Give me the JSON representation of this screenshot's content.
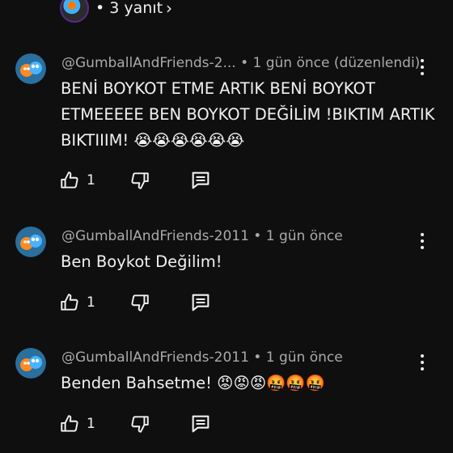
{
  "top_reply_bar": {
    "replies_label": "• 3 yanıt",
    "chevron_icon": "chevron-right-icon"
  },
  "comments": [
    {
      "author": "@GumballAndFriends-2...",
      "meta_suffix": "• 1 gün önce (düzenlendi)",
      "text": "BENİ BOYKOT ETME ARTIK BENİ BOYKOT ETMEEEEE BEN BOYKOT DEĞİLİM !BIKTIM ARTIK BIKTIIIM! 😭😭😭😭😭😭",
      "likes": "1"
    },
    {
      "author": "@GumballAndFriends-2011",
      "meta_suffix": "• 1 gün önce",
      "text": "Ben Boykot Değilim!",
      "likes": "1"
    },
    {
      "author": "@GumballAndFriends-2011",
      "meta_suffix": "• 1 gün önce",
      "text": "Benden Bahsetme! 😡😡😡🤬🤬🤬",
      "likes": "1"
    }
  ],
  "icons": {
    "like": "thumbs-up-icon",
    "dislike": "thumbs-down-icon",
    "reply": "reply-comment-icon",
    "more": "more-vertical-icon"
  },
  "colors": {
    "background": "#0f0f0f",
    "text": "#f1f1f1",
    "meta": "#aaaaaa"
  }
}
